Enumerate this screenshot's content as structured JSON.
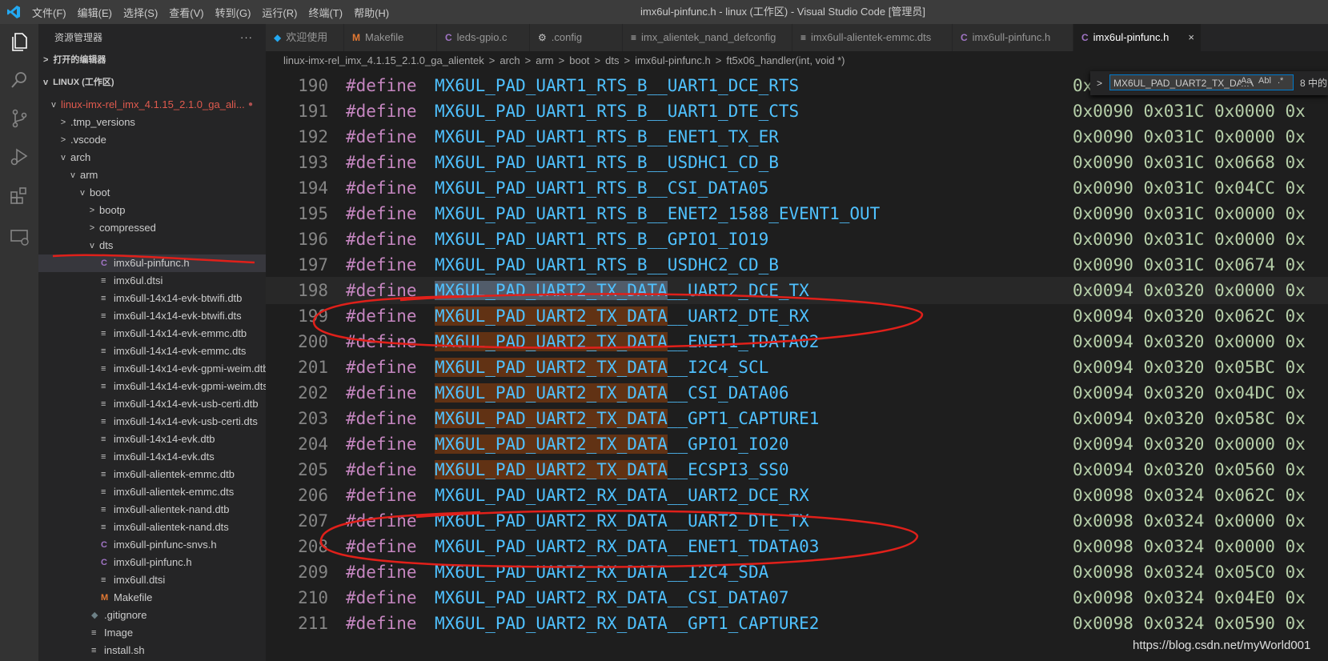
{
  "titlebar": {
    "menus": [
      "文件(F)",
      "编辑(E)",
      "选择(S)",
      "查看(V)",
      "转到(G)",
      "运行(R)",
      "终端(T)",
      "帮助(H)"
    ],
    "window_title": "imx6ul-pinfunc.h - linux (工作区) - Visual Studio Code [管理员]"
  },
  "sidebar": {
    "title": "资源管理器",
    "more": "···",
    "open_editors": "打开的编辑器",
    "workspace": "LINUX (工作区)",
    "tree": [
      {
        "label": "linux-imx-rel_imx_4.1.15_2.1.0_ga_ali...",
        "twistie": "v",
        "icon": "",
        "dot": "●"
      },
      {
        "label": ".tmp_versions",
        "twistie": ">",
        "icon": ""
      },
      {
        "label": ".vscode",
        "twistie": ">",
        "icon": ""
      },
      {
        "label": "arch",
        "twistie": "v",
        "icon": ""
      },
      {
        "label": "arm",
        "twistie": "v",
        "icon": ""
      },
      {
        "label": "boot",
        "twistie": "v",
        "icon": ""
      },
      {
        "label": "bootp",
        "twistie": ">",
        "icon": ""
      },
      {
        "label": "compressed",
        "twistie": ">",
        "icon": ""
      },
      {
        "label": "dts",
        "twistie": "v",
        "icon": ""
      },
      {
        "label": "imx6ul-pinfunc.h",
        "twistie": "",
        "icon": "C"
      },
      {
        "label": "imx6ul.dtsi",
        "twistie": "",
        "icon": "≡"
      },
      {
        "label": "imx6ull-14x14-evk-btwifi.dtb",
        "twistie": "",
        "icon": "≡"
      },
      {
        "label": "imx6ull-14x14-evk-btwifi.dts",
        "twistie": "",
        "icon": "≡"
      },
      {
        "label": "imx6ull-14x14-evk-emmc.dtb",
        "twistie": "",
        "icon": "≡"
      },
      {
        "label": "imx6ull-14x14-evk-emmc.dts",
        "twistie": "",
        "icon": "≡"
      },
      {
        "label": "imx6ull-14x14-evk-gpmi-weim.dtb",
        "twistie": "",
        "icon": "≡"
      },
      {
        "label": "imx6ull-14x14-evk-gpmi-weim.dts",
        "twistie": "",
        "icon": "≡"
      },
      {
        "label": "imx6ull-14x14-evk-usb-certi.dtb",
        "twistie": "",
        "icon": "≡"
      },
      {
        "label": "imx6ull-14x14-evk-usb-certi.dts",
        "twistie": "",
        "icon": "≡"
      },
      {
        "label": "imx6ull-14x14-evk.dtb",
        "twistie": "",
        "icon": "≡"
      },
      {
        "label": "imx6ull-14x14-evk.dts",
        "twistie": "",
        "icon": "≡"
      },
      {
        "label": "imx6ull-alientek-emmc.dtb",
        "twistie": "",
        "icon": "≡"
      },
      {
        "label": "imx6ull-alientek-emmc.dts",
        "twistie": "",
        "icon": "≡"
      },
      {
        "label": "imx6ull-alientek-nand.dtb",
        "twistie": "",
        "icon": "≡"
      },
      {
        "label": "imx6ull-alientek-nand.dts",
        "twistie": "",
        "icon": "≡"
      },
      {
        "label": "imx6ull-pinfunc-snvs.h",
        "twistie": "",
        "icon": "C"
      },
      {
        "label": "imx6ull-pinfunc.h",
        "twistie": "",
        "icon": "C"
      },
      {
        "label": "imx6ull.dtsi",
        "twistie": "",
        "icon": "≡"
      },
      {
        "label": "Makefile",
        "twistie": "",
        "icon": "M"
      },
      {
        "label": ".gitignore",
        "twistie": "",
        "icon": "◆"
      },
      {
        "label": "Image",
        "twistie": "",
        "icon": "≡"
      },
      {
        "label": "install.sh",
        "twistie": "",
        "icon": "≡"
      },
      {
        "label": "Makefile",
        "twistie": "",
        "icon": "M"
      }
    ]
  },
  "tabs": [
    {
      "label": "欢迎使用",
      "icon": "◆",
      "active": false
    },
    {
      "label": "Makefile",
      "icon": "M",
      "active": false
    },
    {
      "label": "leds-gpio.c",
      "icon": "C",
      "active": false
    },
    {
      "label": ".config",
      "icon": "⚙",
      "active": false
    },
    {
      "label": "imx_alientek_nand_defconfig",
      "icon": "≡",
      "active": false
    },
    {
      "label": "imx6ull-alientek-emmc.dts",
      "icon": "≡",
      "active": false
    },
    {
      "label": "imx6ull-pinfunc.h",
      "icon": "C",
      "active": false
    },
    {
      "label": "imx6ul-pinfunc.h",
      "icon": "C",
      "active": true
    }
  ],
  "tab_close": "×",
  "breadcrumb": [
    "linux-imx-rel_imx_4.1.15_2.1.0_ga_alientek",
    ">",
    "arch",
    ">",
    "arm",
    ">",
    "boot",
    ">",
    "dts",
    ">",
    "imx6ul-pinfunc.h",
    ">",
    "ft5x06_handler(int, void *)"
  ],
  "find_widget": {
    "query": "MX6UL_PAD_UART2_TX_DATA",
    "count": "8 中的",
    "toggle": ">",
    "opt_case": "Aa",
    "opt_word": "Abl",
    "opt_regex": ".*"
  },
  "code": {
    "keyword": "#define",
    "lines": [
      {
        "n": "190",
        "prefix": "MX6UL_PAD_UART1_RTS_B",
        "suffix": "__UART1_DCE_RTS",
        "vals": "0x0090 0x031C 0x0000 0x"
      },
      {
        "n": "191",
        "prefix": "MX6UL_PAD_UART1_RTS_B",
        "suffix": "__UART1_DTE_CTS",
        "vals": "0x0090 0x031C 0x0000 0x"
      },
      {
        "n": "192",
        "prefix": "MX6UL_PAD_UART1_RTS_B",
        "suffix": "__ENET1_TX_ER",
        "vals": "0x0090 0x031C 0x0000 0x"
      },
      {
        "n": "193",
        "prefix": "MX6UL_PAD_UART1_RTS_B",
        "suffix": "__USDHC1_CD_B",
        "vals": "0x0090 0x031C 0x0668 0x"
      },
      {
        "n": "194",
        "prefix": "MX6UL_PAD_UART1_RTS_B",
        "suffix": "__CSI_DATA05",
        "vals": "0x0090 0x031C 0x04CC 0x"
      },
      {
        "n": "195",
        "prefix": "MX6UL_PAD_UART1_RTS_B",
        "suffix": "__ENET2_1588_EVENT1_OUT",
        "vals": "0x0090 0x031C 0x0000 0x"
      },
      {
        "n": "196",
        "prefix": "MX6UL_PAD_UART1_RTS_B",
        "suffix": "__GPIO1_IO19",
        "vals": "0x0090 0x031C 0x0000 0x"
      },
      {
        "n": "197",
        "prefix": "MX6UL_PAD_UART1_RTS_B",
        "suffix": "__USDHC2_CD_B",
        "vals": "0x0090 0x031C 0x0674 0x"
      },
      {
        "n": "198",
        "prefix": "MX6UL_PAD_UART2_TX_DATA",
        "suffix": "__UART2_DCE_TX",
        "vals": "0x0094 0x0320 0x0000 0x"
      },
      {
        "n": "199",
        "prefix": "MX6UL_PAD_UART2_TX_DATA",
        "suffix": "__UART2_DTE_RX",
        "vals": "0x0094 0x0320 0x062C 0x"
      },
      {
        "n": "200",
        "prefix": "MX6UL_PAD_UART2_TX_DATA",
        "suffix": "__ENET1_TDATA02",
        "vals": "0x0094 0x0320 0x0000 0x"
      },
      {
        "n": "201",
        "prefix": "MX6UL_PAD_UART2_TX_DATA",
        "suffix": "__I2C4_SCL",
        "vals": "0x0094 0x0320 0x05BC 0x"
      },
      {
        "n": "202",
        "prefix": "MX6UL_PAD_UART2_TX_DATA",
        "suffix": "__CSI_DATA06",
        "vals": "0x0094 0x0320 0x04DC 0x"
      },
      {
        "n": "203",
        "prefix": "MX6UL_PAD_UART2_TX_DATA",
        "suffix": "__GPT1_CAPTURE1",
        "vals": "0x0094 0x0320 0x058C 0x"
      },
      {
        "n": "204",
        "prefix": "MX6UL_PAD_UART2_TX_DATA",
        "suffix": "__GPIO1_IO20",
        "vals": "0x0094 0x0320 0x0000 0x"
      },
      {
        "n": "205",
        "prefix": "MX6UL_PAD_UART2_TX_DATA",
        "suffix": "__ECSPI3_SS0",
        "vals": "0x0094 0x0320 0x0560 0x"
      },
      {
        "n": "206",
        "prefix": "MX6UL_PAD_UART2_RX_DATA",
        "suffix": "__UART2_DCE_RX",
        "vals": "0x0098 0x0324 0x062C 0x"
      },
      {
        "n": "207",
        "prefix": "MX6UL_PAD_UART2_RX_DATA",
        "suffix": "__UART2_DTE_TX",
        "vals": "0x0098 0x0324 0x0000 0x"
      },
      {
        "n": "208",
        "prefix": "MX6UL_PAD_UART2_RX_DATA",
        "suffix": "__ENET1_TDATA03",
        "vals": "0x0098 0x0324 0x0000 0x"
      },
      {
        "n": "209",
        "prefix": "MX6UL_PAD_UART2_RX_DATA",
        "suffix": "__I2C4_SDA",
        "vals": "0x0098 0x0324 0x05C0 0x"
      },
      {
        "n": "210",
        "prefix": "MX6UL_PAD_UART2_RX_DATA",
        "suffix": "__CSI_DATA07",
        "vals": "0x0098 0x0324 0x04E0 0x"
      },
      {
        "n": "211",
        "prefix": "MX6UL_PAD_UART2_RX_DATA",
        "suffix": "__GPT1_CAPTURE2",
        "vals": "0x0098 0x0324 0x0590 0x"
      }
    ]
  },
  "watermark": "https://blog.csdn.net/myWorld001",
  "colors": {
    "keyword": "#c586c0",
    "macro": "#4fc1ff",
    "number": "#b5cea8",
    "find_match": "#613214",
    "annotation": "#e0201a"
  }
}
